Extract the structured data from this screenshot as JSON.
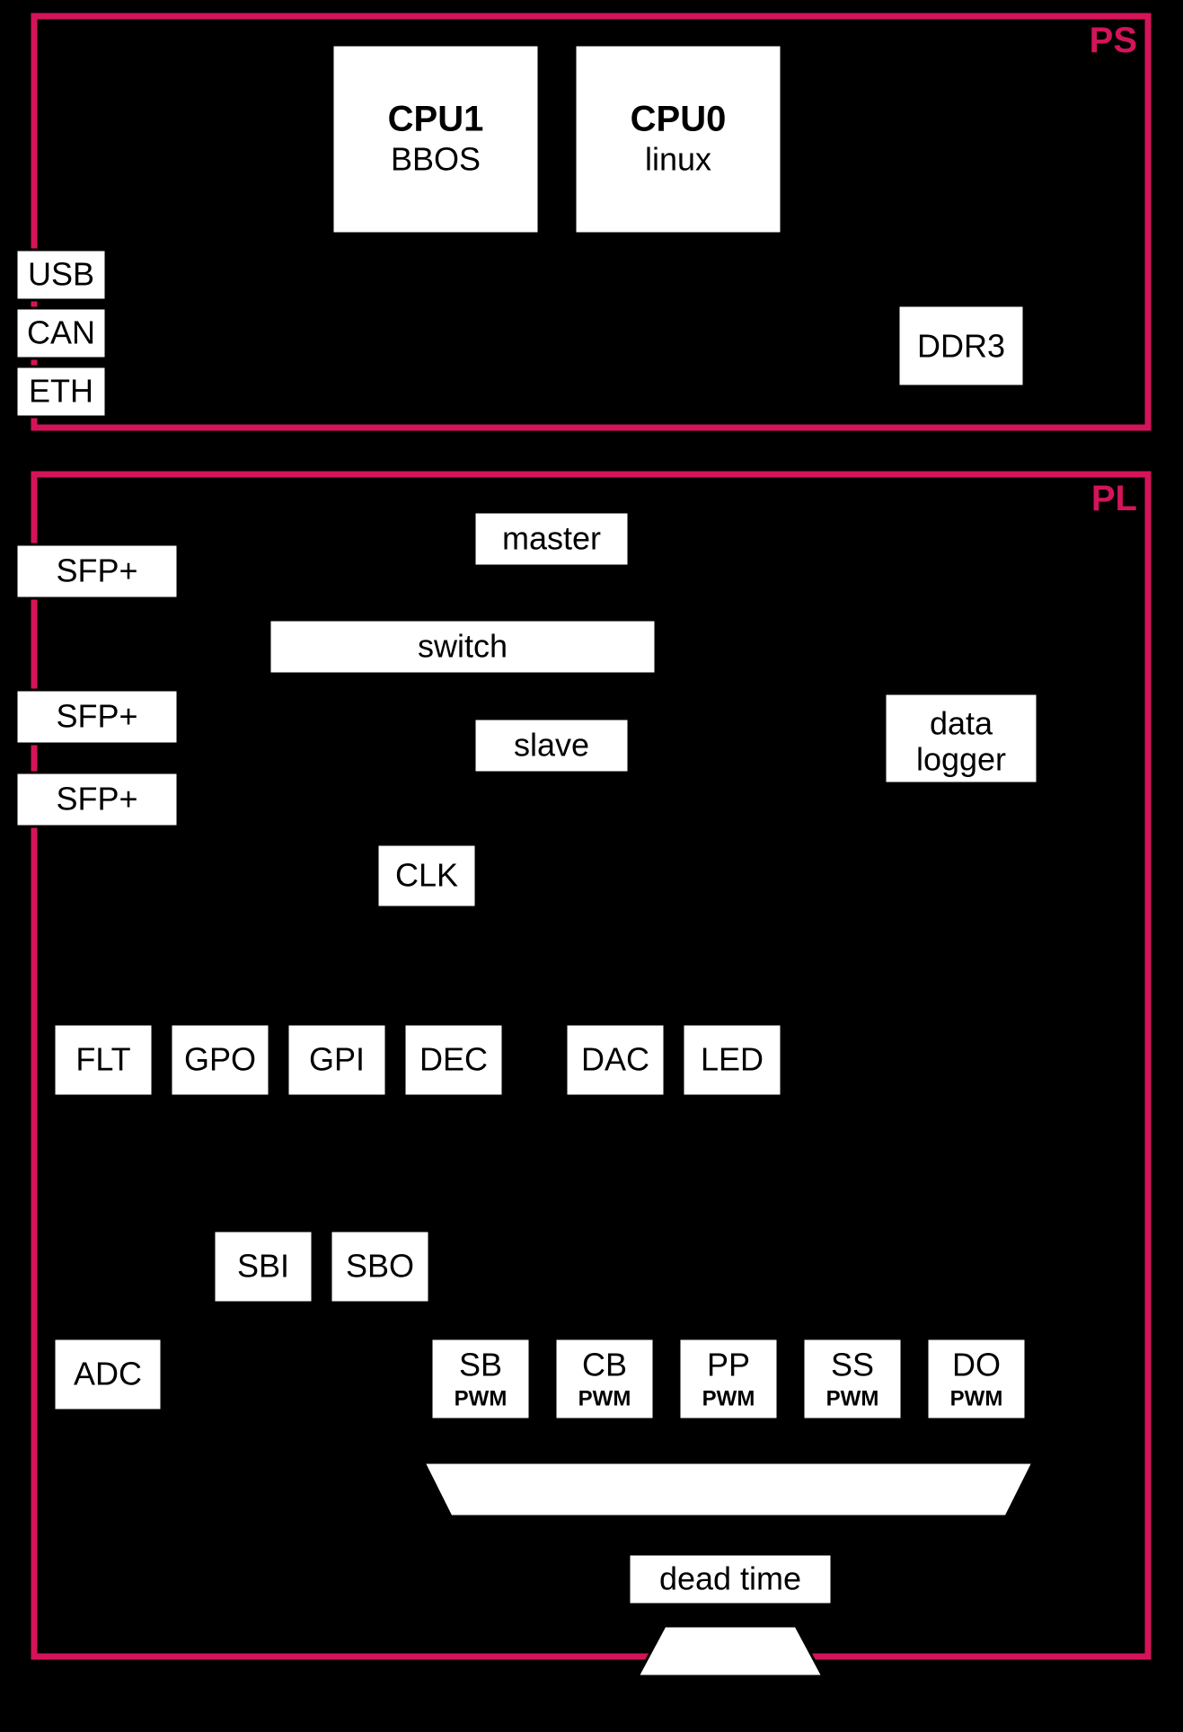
{
  "regions": {
    "ps": {
      "label": "PS"
    },
    "pl": {
      "label": "PL"
    }
  },
  "ps": {
    "cpu1": {
      "title": "CPU1",
      "os": "BBOS"
    },
    "cpu0": {
      "title": "CPU0",
      "os": "linux"
    },
    "usb": "USB",
    "can": "CAN",
    "eth": "ETH",
    "ddr3": "DDR3"
  },
  "pl": {
    "sfp1": "SFP+",
    "sfp2": "SFP+",
    "sfp3": "SFP+",
    "master": "master",
    "switch": "switch",
    "slave": "slave",
    "clk": "CLK",
    "data_logger_l1": "data",
    "data_logger_l2": "logger",
    "row1": {
      "flt": "FLT",
      "gpo": "GPO",
      "gpi": "GPI",
      "dec": "DEC",
      "dac": "DAC",
      "led": "LED"
    },
    "sbi": "SBI",
    "sbo": "SBO",
    "adc": "ADC",
    "pwm": {
      "sb": {
        "t": "SB",
        "b": "PWM"
      },
      "cb": {
        "t": "CB",
        "b": "PWM"
      },
      "pp": {
        "t": "PP",
        "b": "PWM"
      },
      "ss": {
        "t": "SS",
        "b": "PWM"
      },
      "do": {
        "t": "DO",
        "b": "PWM"
      }
    },
    "dead_time": "dead time"
  }
}
